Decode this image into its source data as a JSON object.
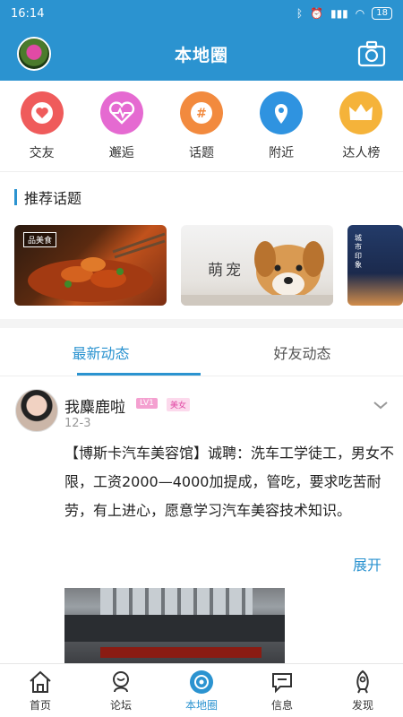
{
  "status": {
    "time": "16:14",
    "battery": "18"
  },
  "header": {
    "title": "本地圈"
  },
  "quick": [
    {
      "label": "交友",
      "color": "#ef5b5b",
      "icon": "heart-icon"
    },
    {
      "label": "邂逅",
      "color": "#e56ad1",
      "icon": "heartbeat-icon"
    },
    {
      "label": "话题",
      "color": "#f28a3e",
      "icon": "hashtag-icon"
    },
    {
      "label": "附近",
      "color": "#2f93e0",
      "icon": "location-icon"
    },
    {
      "label": "达人榜",
      "color": "#f5b33a",
      "icon": "crown-icon"
    }
  ],
  "recommend": {
    "title": "推荐话题",
    "topics": [
      {
        "tag": "品美食"
      },
      {
        "label": "萌宠"
      },
      {
        "label": "城市印象"
      }
    ]
  },
  "tabs": [
    "最新动态",
    "好友动态"
  ],
  "post": {
    "username": "我麋鹿啦",
    "level": "LV1",
    "gender_badge": "美女",
    "date": "12-3",
    "content": "【博斯卡汽车美容馆】诚聘：洗车工学徒工，男女不限，工资2000—4000加提成，管吃，要求吃苦耐劳，有上进心，愿意学习汽车美容技术知识。",
    "expand": "展开"
  },
  "nav": [
    {
      "label": "首页",
      "icon": "home-icon"
    },
    {
      "label": "论坛",
      "icon": "forum-icon"
    },
    {
      "label": "本地圈",
      "icon": "local-circle-icon"
    },
    {
      "label": "信息",
      "icon": "message-icon"
    },
    {
      "label": "发现",
      "icon": "rocket-icon"
    }
  ],
  "colors": {
    "accent": "#2b93d0"
  }
}
